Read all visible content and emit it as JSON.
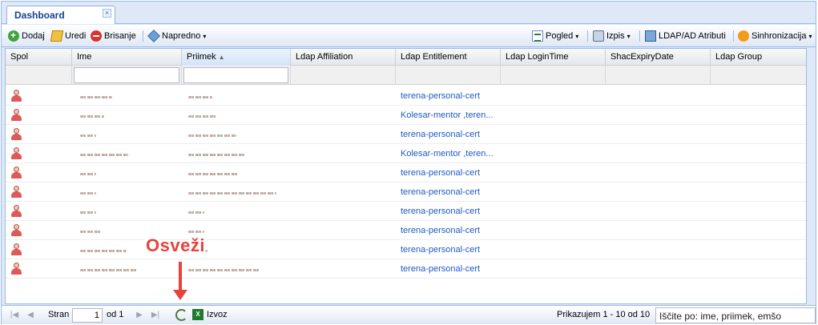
{
  "tab": {
    "title": "Dashboard",
    "close_glyph": "×"
  },
  "toolbar": {
    "add": "Dodaj",
    "edit": "Uredi",
    "delete": "Brisanje",
    "advanced": "Napredno",
    "view": "Pogled",
    "print": "Izpis",
    "ldap_attributes": "LDAP/AD Atributi",
    "sync": "Sinhronizacija",
    "caret": "▾"
  },
  "grid": {
    "columns": [
      "Spol",
      "Ime",
      "Priimek",
      "Ldap Affiliation",
      "Ldap Entitlement",
      "Ldap LoginTime",
      "ShacExpiryDate",
      "Ldap Group"
    ],
    "sort_indicator": "▲",
    "rows": [
      {
        "entitlement": "terena-personal-cert"
      },
      {
        "entitlement": "Kolesar-mentor ,teren..."
      },
      {
        "entitlement": "terena-personal-cert"
      },
      {
        "entitlement": "Kolesar-mentor ,teren..."
      },
      {
        "entitlement": "terena-personal-cert"
      },
      {
        "entitlement": "terena-personal-cert"
      },
      {
        "entitlement": "terena-personal-cert"
      },
      {
        "entitlement": "terena-personal-cert"
      },
      {
        "entitlement": "terena-personal-cert"
      },
      {
        "entitlement": "terena-personal-cert"
      }
    ]
  },
  "pager": {
    "page_label": "Stran",
    "page_value": "1",
    "of_label": "od 1",
    "export": "Izvoz",
    "status": "Prikazujem 1 - 10 od 10",
    "search_value": "Iščite po: ime, priimek, emšo",
    "first_glyph": "|◀",
    "prev_glyph": "◀",
    "next_glyph": "▶",
    "last_glyph": "▶|",
    "xls_glyph": "X"
  },
  "annotation": {
    "label": "Osveži"
  },
  "colors": {
    "accent": "#99bbe8",
    "link": "#1f5bc6",
    "annotation": "#e8423c"
  }
}
